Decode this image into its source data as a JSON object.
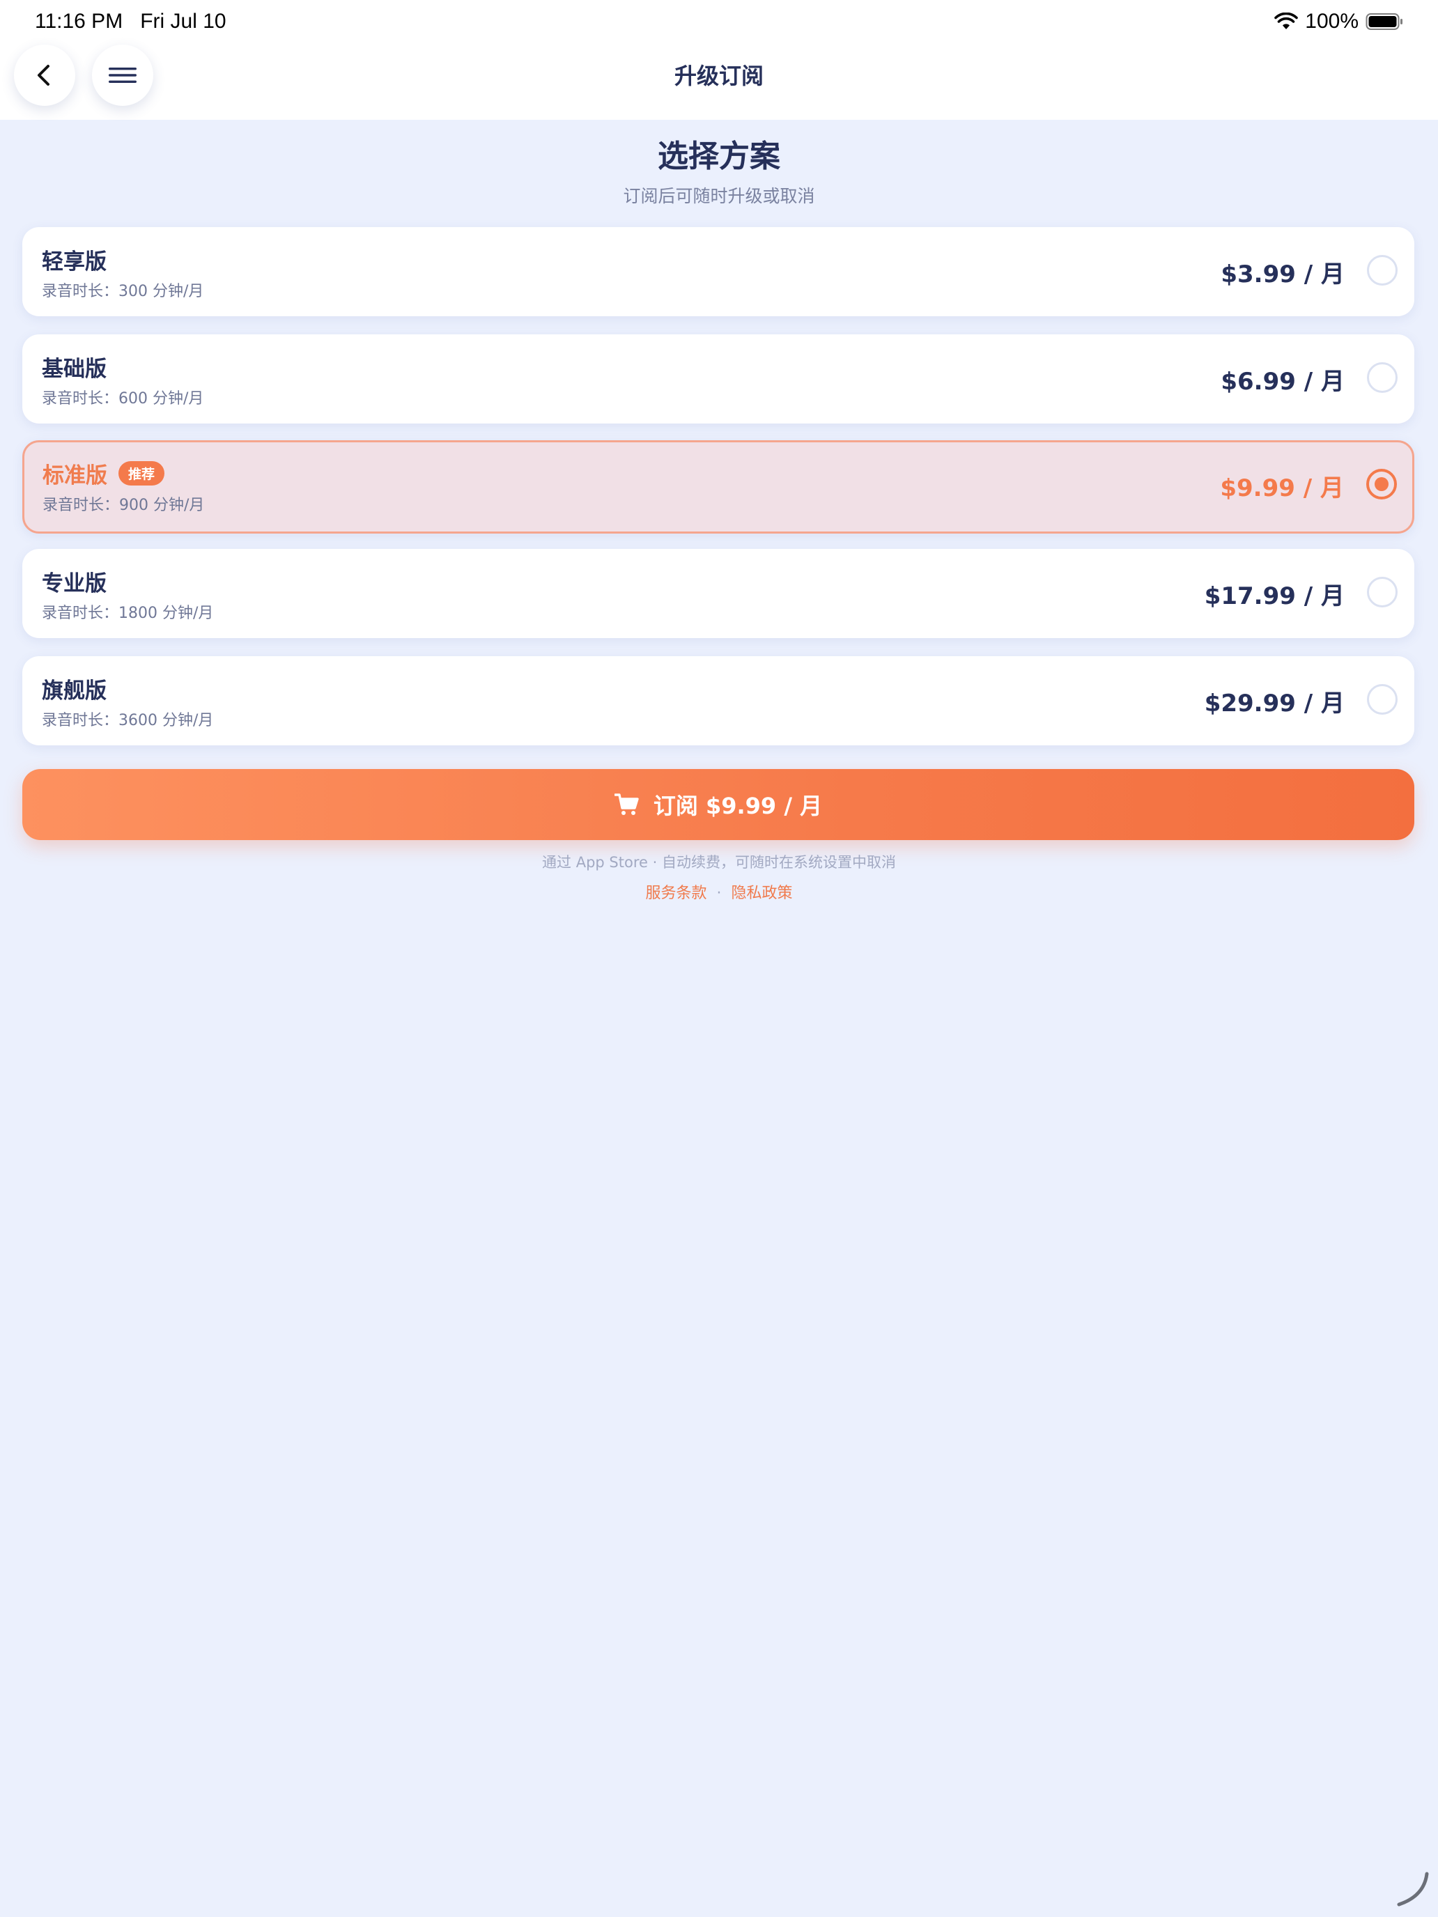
{
  "status_bar": {
    "time": "11:16 PM",
    "date": "Fri Jul 10",
    "battery": "100%"
  },
  "nav": {
    "title": "升级订阅",
    "back_icon": "chevron-left-icon",
    "menu_icon": "hamburger-menu-icon"
  },
  "header": {
    "title": "选择方案",
    "subtitle": "订阅后可随时升级或取消"
  },
  "plans": [
    {
      "name": "轻享版",
      "desc": "录音时长：300 分钟/月",
      "price": "$3.99 / 月",
      "selected": false
    },
    {
      "name": "基础版",
      "desc": "录音时长：600 分钟/月",
      "price": "$6.99 / 月",
      "selected": false
    },
    {
      "name": "标准版",
      "badge": "推荐",
      "desc": "录音时长：900 分钟/月",
      "price": "$9.99 / 月",
      "selected": true
    },
    {
      "name": "专业版",
      "desc": "录音时长：1800 分钟/月",
      "price": "$17.99 / 月",
      "selected": false
    },
    {
      "name": "旗舰版",
      "desc": "录音时长：3600 分钟/月",
      "price": "$29.99 / 月",
      "selected": false
    }
  ],
  "cta": {
    "label": "订阅 $9.99 / 月",
    "icon": "cart-icon"
  },
  "fine_print": "通过 App Store · 自动续费，可随时在系统设置中取消",
  "links": {
    "terms": "服务条款",
    "separator": "·",
    "privacy": "隐私政策"
  },
  "colors": {
    "accent": "#f47a4b",
    "text_dark": "#26305a",
    "background": "#ebf0fd",
    "selected_bg": "#f1e0e6"
  }
}
